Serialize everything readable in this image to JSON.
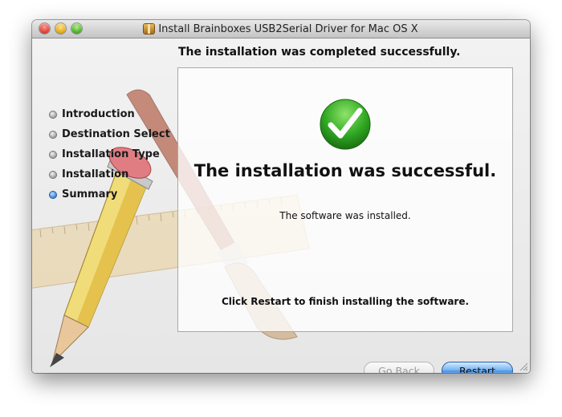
{
  "window": {
    "title": "Install Brainboxes USB2Serial Driver for Mac OS X"
  },
  "header": {
    "headline": "The installation was completed successfully."
  },
  "sidebar": {
    "steps": [
      {
        "label": "Introduction",
        "active": false
      },
      {
        "label": "Destination Select",
        "active": false
      },
      {
        "label": "Installation Type",
        "active": false
      },
      {
        "label": "Installation",
        "active": false
      },
      {
        "label": "Summary",
        "active": true
      }
    ]
  },
  "main": {
    "icon": "success-checkmark-icon",
    "success_title": "The installation was successful.",
    "installed_text": "The software was installed.",
    "restart_message": "Click Restart to finish installing the software."
  },
  "buttons": {
    "back_label": "Go Back",
    "back_enabled": false,
    "restart_label": "Restart"
  },
  "colors": {
    "accent_blue": "#4a95e6",
    "check_green": "#2fa822"
  }
}
